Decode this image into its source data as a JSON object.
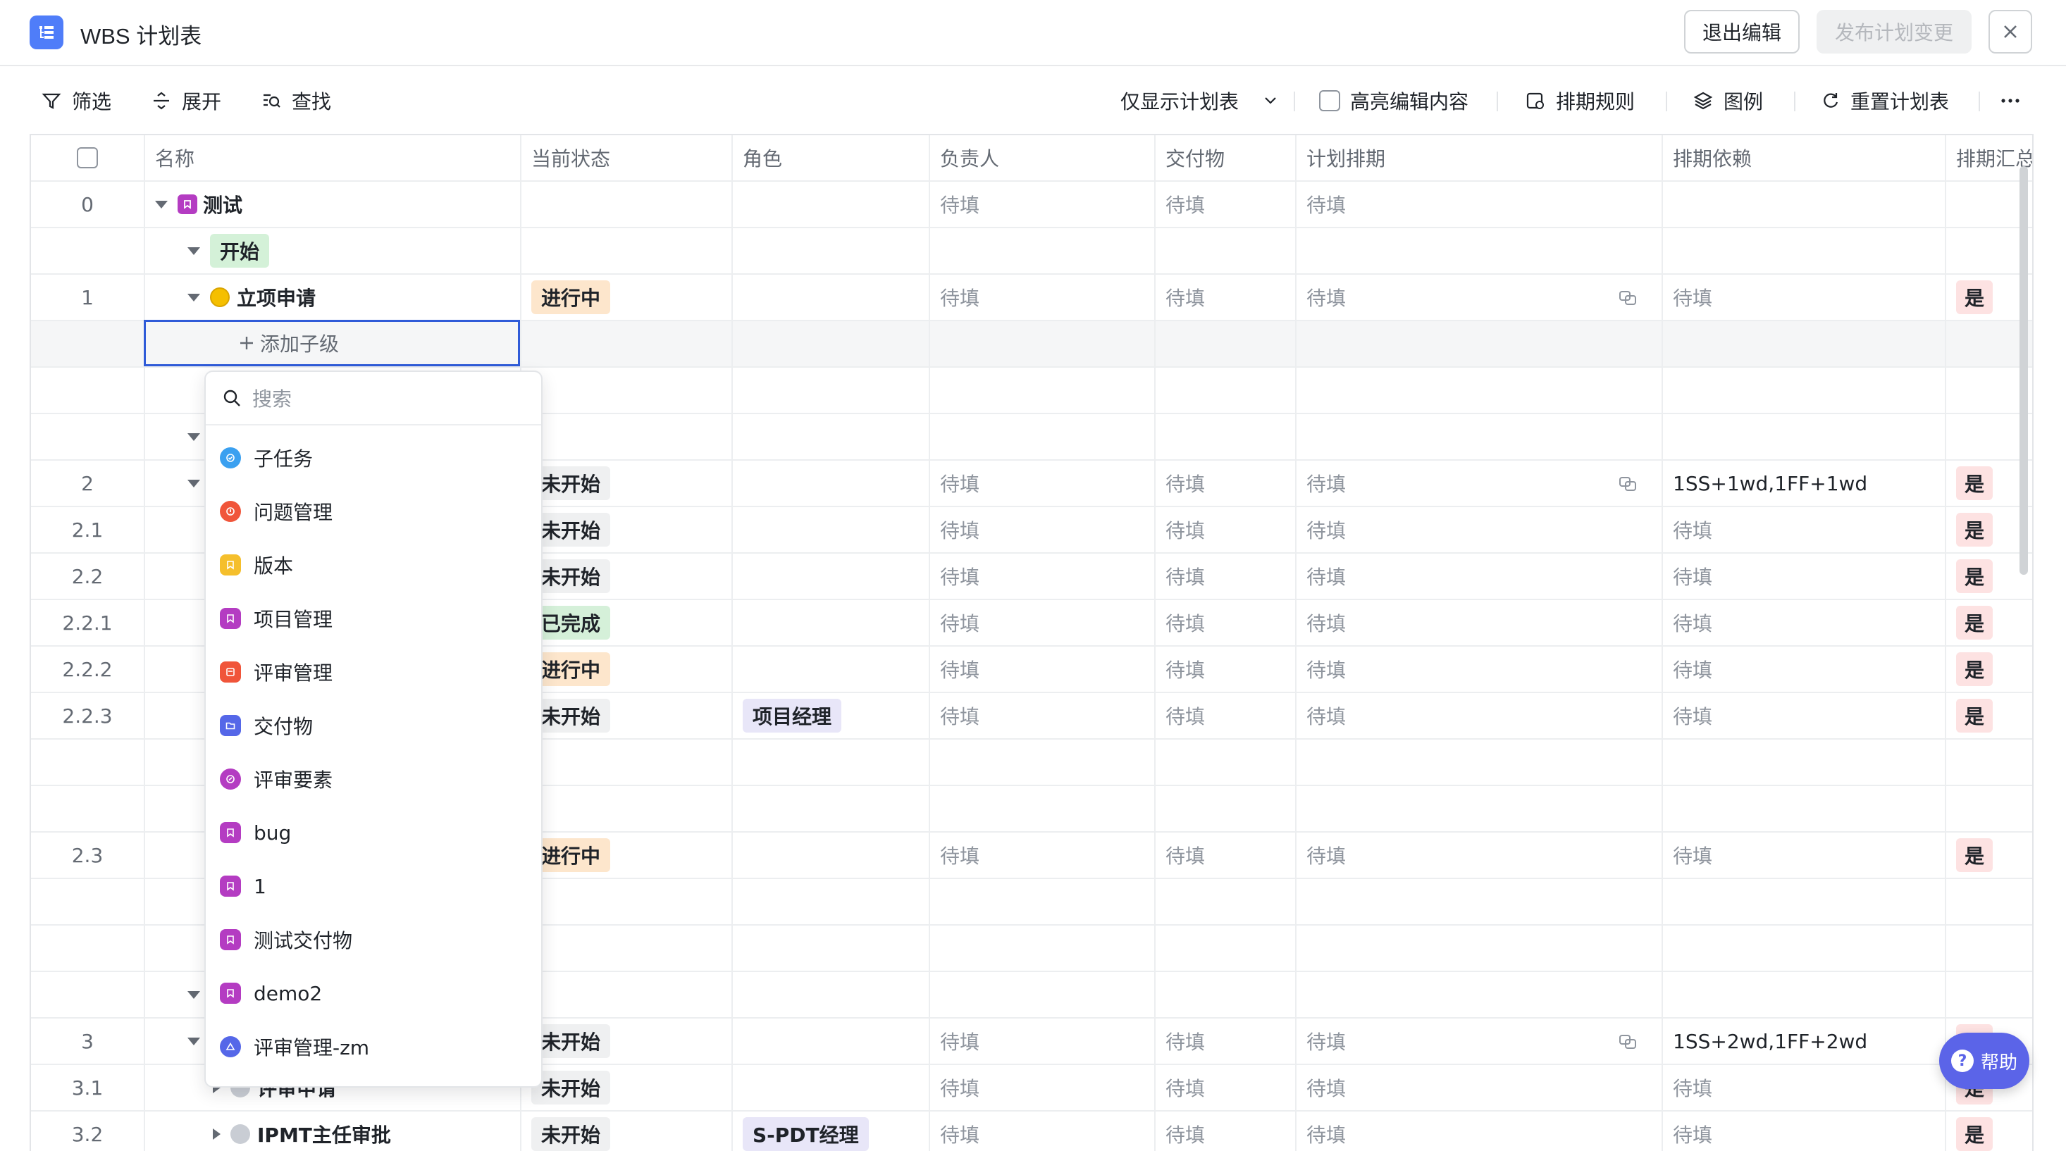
{
  "header": {
    "title": "WBS 计划表",
    "exit_label": "退出编辑",
    "publish_label": "发布计划变更"
  },
  "toolbar": {
    "filter": "筛选",
    "expand": "展开",
    "find": "查找",
    "view_select": "仅显示计划表",
    "highlight": "高亮编辑内容",
    "schedule_rules": "排期规则",
    "legend": "图例",
    "reset": "重置计划表"
  },
  "columns": [
    "名称",
    "当前状态",
    "角色",
    "负责人",
    "交付物",
    "计划排期",
    "排期依赖",
    "排期汇总"
  ],
  "placeholder": "待填",
  "yes": "是",
  "rows": {
    "r0": {
      "num": "0",
      "name": "测试"
    },
    "r1": {
      "name": "开始"
    },
    "r2": {
      "num": "1",
      "name": "立项申请",
      "status": "进行中"
    },
    "r5": {
      "num": "2",
      "status": "未开始",
      "dep": "1SS+1wd,1FF+1wd"
    },
    "r6": {
      "num": "2.1",
      "status": "未开始"
    },
    "r7": {
      "num": "2.2",
      "status": "未开始"
    },
    "r8": {
      "num": "2.2.1",
      "status": "已完成"
    },
    "r9": {
      "num": "2.2.2",
      "status": "进行中"
    },
    "r10": {
      "num": "2.2.3",
      "status": "未开始",
      "role": "项目经理"
    },
    "r13": {
      "num": "2.3",
      "status": "进行中"
    },
    "r17": {
      "num": "3",
      "status": "未开始",
      "dep": "1SS+2wd,1FF+2wd"
    },
    "r18": {
      "num": "3.1",
      "name": "评审申请",
      "status": "未开始"
    },
    "r19": {
      "num": "3.2",
      "name": "IPMT主任审批",
      "status": "未开始",
      "role": "S-PDT经理"
    }
  },
  "add_child": {
    "label": "添加子级"
  },
  "dropdown": {
    "search_placeholder": "搜索",
    "items": [
      {
        "label": "子任务",
        "color": "#3aa0f0"
      },
      {
        "label": "问题管理",
        "color": "#f0553a"
      },
      {
        "label": "版本",
        "color": "#f5bf2c"
      },
      {
        "label": "项目管理",
        "color": "#b43cc2"
      },
      {
        "label": "评审管理",
        "color": "#f0553a"
      },
      {
        "label": "交付物",
        "color": "#5567e8"
      },
      {
        "label": "评审要素",
        "color": "#b43cc2"
      },
      {
        "label": "bug",
        "color": "#b43cc2"
      },
      {
        "label": "1",
        "color": "#b43cc2"
      },
      {
        "label": "测试交付物",
        "color": "#b43cc2"
      },
      {
        "label": "demo2",
        "color": "#b43cc2"
      },
      {
        "label": "评审管理-zm",
        "color": "#5567e8"
      }
    ]
  },
  "help": {
    "label": "帮助"
  }
}
